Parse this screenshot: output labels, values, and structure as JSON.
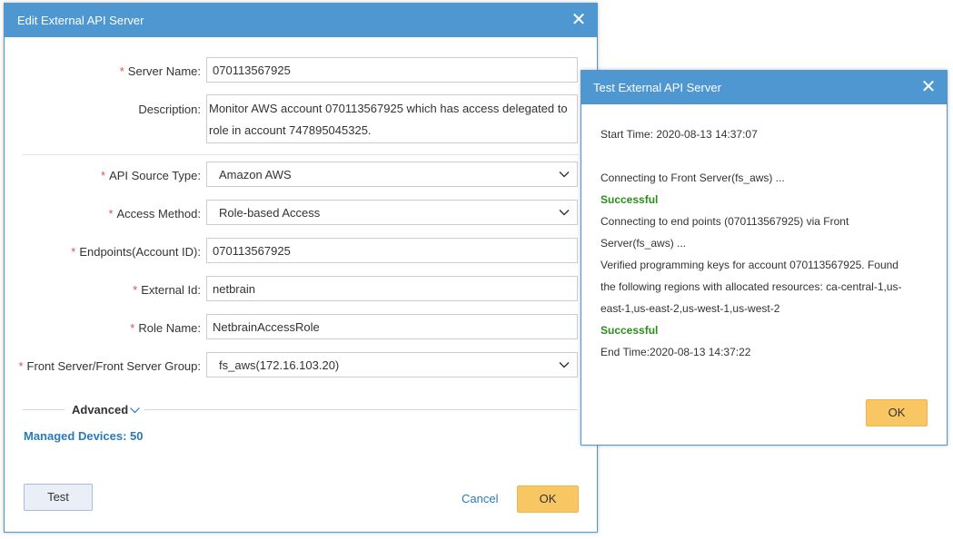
{
  "edit_dialog": {
    "title": "Edit External API Server",
    "close_glyph": "✕",
    "required_mark": "*",
    "server_name": {
      "label": "Server Name:",
      "value": "070113567925"
    },
    "description": {
      "label": "Description:",
      "value": "Monitor AWS account 070113567925 which has access delegated to role in account 747895045325."
    },
    "api_source_type": {
      "label": "API Source Type:",
      "value": "Amazon AWS"
    },
    "access_method": {
      "label": "Access Method:",
      "value": "Role-based Access"
    },
    "endpoints": {
      "label": "Endpoints(Account ID):",
      "value": "070113567925"
    },
    "external_id": {
      "label": "External Id:",
      "value": "netbrain"
    },
    "role_name": {
      "label": "Role Name:",
      "value": "NetbrainAccessRole"
    },
    "front_server": {
      "label": "Front Server/Front Server Group:",
      "value": "fs_aws(172.16.103.20)"
    },
    "advanced_label": "Advanced",
    "managed_devices": "Managed Devices: 50",
    "test_button": "Test",
    "cancel_link": "Cancel",
    "ok_button": "OK"
  },
  "test_dialog": {
    "title": "Test External API Server",
    "close_glyph": "✕",
    "start_time": "Start Time: 2020-08-13 14:37:07",
    "connect_front": "Connecting to Front Server(fs_aws) ...",
    "success_1": "Successful",
    "connect_endpoints_1": "Connecting to end points (070113567925) via Front",
    "connect_endpoints_2": "Server(fs_aws) ...",
    "verified_1": "Verified programming keys for account 070113567925. Found",
    "verified_2": "the following regions with allocated resources: ca-central-1,us-",
    "verified_3": "east-1,us-east-2,us-west-1,us-west-2",
    "success_2": "Successful",
    "end_time": "End Time:2020-08-13 14:37:22",
    "ok_button": "OK"
  },
  "colors": {
    "titlebar": "#4f97d0",
    "success": "#2c8c1c",
    "link": "#2a7ab8",
    "ok_button": "#f9c664",
    "required": "#d9534f"
  },
  "icons": [
    "close-icon",
    "chevron-down-icon"
  ]
}
